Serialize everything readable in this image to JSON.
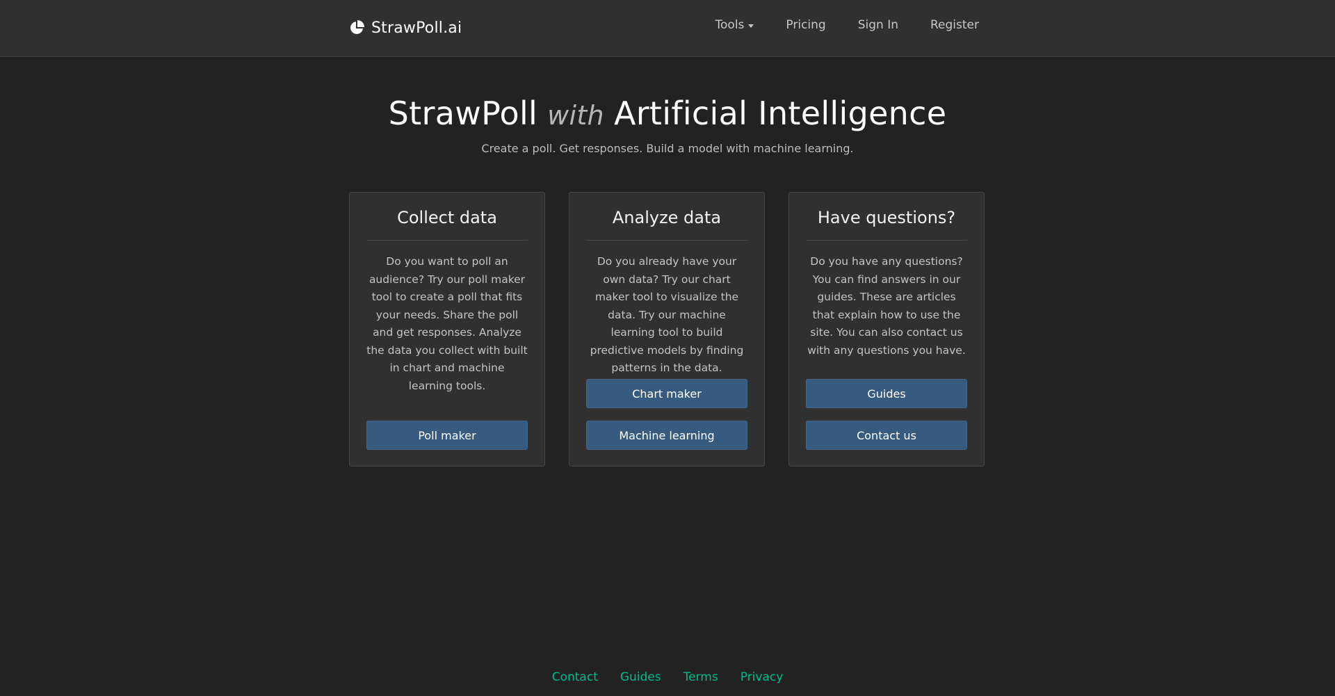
{
  "navbar": {
    "brand": "StrawPoll.ai",
    "brand_icon": "pie-chart-icon",
    "links": {
      "tools": "Tools",
      "pricing": "Pricing",
      "sign_in": "Sign In",
      "register": "Register"
    }
  },
  "hero": {
    "title_part1": "StrawPoll",
    "title_with": "with",
    "title_part2": "Artificial Intelligence",
    "subtitle": "Create a poll. Get responses. Build a model with machine learning."
  },
  "cards": [
    {
      "title": "Collect data",
      "text": "Do you want to poll an audience? Try our poll maker tool to create a poll that fits your needs. Share the poll and get responses. Analyze the data you collect with built in chart and machine learning tools.",
      "buttons": [
        "Poll maker"
      ]
    },
    {
      "title": "Analyze data",
      "text": "Do you already have your own data? Try our chart maker tool to visualize the data. Try our machine learning tool to build predictive models by finding patterns in the data.",
      "buttons": [
        "Chart maker",
        "Machine learning"
      ]
    },
    {
      "title": "Have questions?",
      "text": "Do you have any questions? You can find answers in our guides. These are articles that explain how to use the site. You can also contact us with any questions you have.",
      "buttons": [
        "Guides",
        "Contact us"
      ]
    }
  ],
  "footer": {
    "links": [
      "Contact",
      "Guides",
      "Terms",
      "Privacy"
    ]
  },
  "colors": {
    "background": "#222222",
    "navbar": "#303030",
    "card": "#303030",
    "button": "#375a7f",
    "footer_link": "#00bc8c"
  }
}
